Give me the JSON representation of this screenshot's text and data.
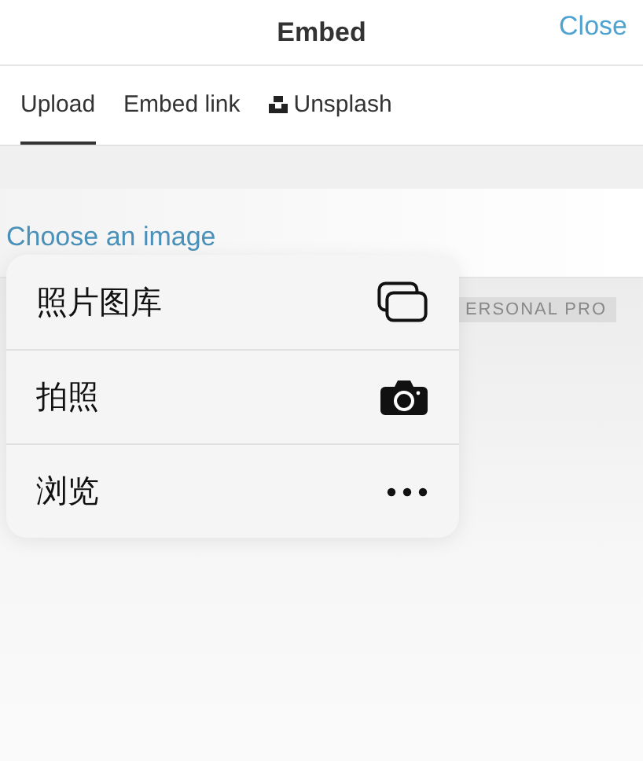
{
  "header": {
    "title": "Embed",
    "close": "Close"
  },
  "tabs": [
    {
      "label": "Upload",
      "selected": true,
      "icon": false
    },
    {
      "label": "Embed link",
      "selected": false,
      "icon": false
    },
    {
      "label": "Unsplash",
      "selected": false,
      "icon": true
    }
  ],
  "choose_link": "Choose an image",
  "badge": "ERSONAL PRO",
  "menu": [
    {
      "label": "照片图库",
      "kind": "gallery"
    },
    {
      "label": "拍照",
      "kind": "camera"
    },
    {
      "label": "浏览",
      "kind": "more"
    }
  ]
}
